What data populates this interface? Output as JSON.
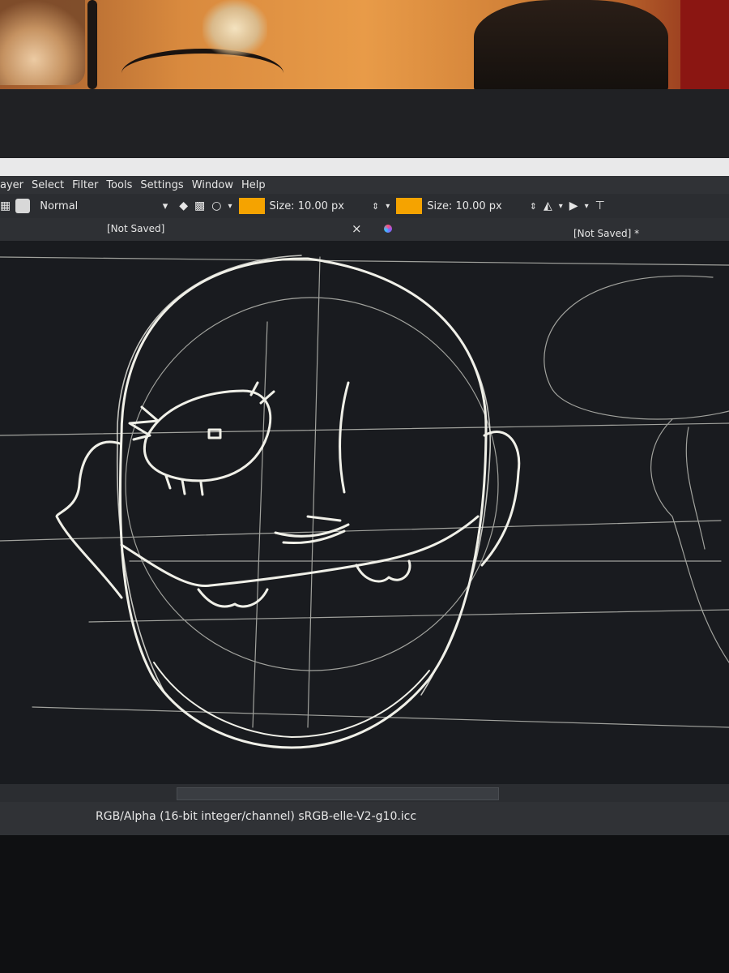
{
  "menu": {
    "items": [
      "ayer",
      "Select",
      "Filter",
      "Tools",
      "Settings",
      "Window",
      "Help"
    ]
  },
  "toolbar": {
    "blend_mode": "Normal",
    "brush_size_1": "Size: 10.00 px",
    "brush_size_2": "Size: 10.00 px",
    "swatch_color": "#f5a300"
  },
  "tabs": [
    {
      "title": "[Not Saved]"
    },
    {
      "title": "[Not Saved] *"
    }
  ],
  "status": {
    "color_profile": "RGB/Alpha (16-bit integer/channel)  sRGB-elle-V2-g10.icc"
  }
}
